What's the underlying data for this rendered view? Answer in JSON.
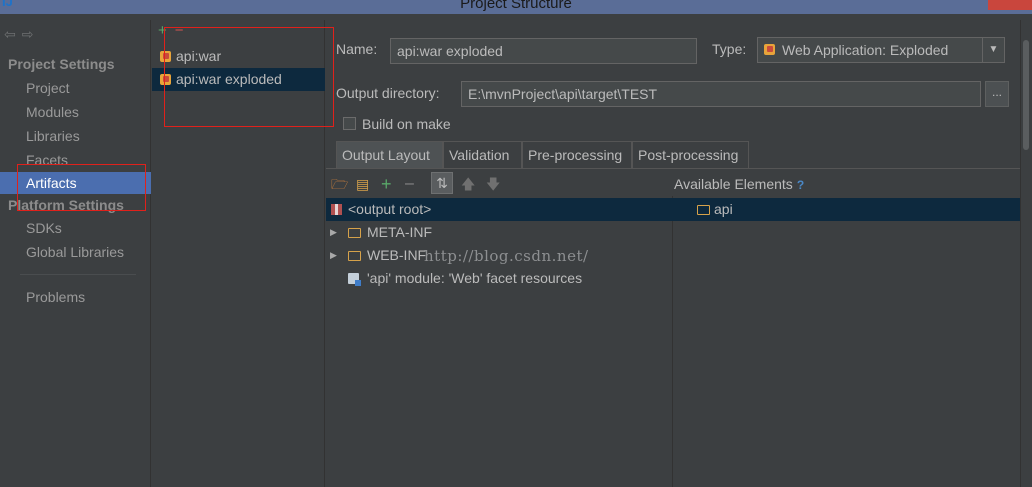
{
  "window": {
    "title": "Project Structure"
  },
  "sidebar": {
    "project_settings_header": "Project Settings",
    "project_items": [
      "Project",
      "Modules",
      "Libraries",
      "Facets",
      "Artifacts"
    ],
    "platform_settings_header": "Platform Settings",
    "platform_items": [
      "SDKs",
      "Global Libraries"
    ],
    "problems": "Problems",
    "selected": "Artifacts"
  },
  "artifacts_list": {
    "add_icon": "+",
    "remove_icon": "−",
    "items": [
      "api:war",
      "api:war exploded"
    ],
    "selected": "api:war exploded"
  },
  "form": {
    "name_label": "Name:",
    "name_value": "api:war exploded",
    "type_label": "Type:",
    "type_value": "Web Application: Exploded",
    "output_dir_label": "Output directory:",
    "output_dir_value": "E:\\mvnProject\\api\\target\\TEST",
    "browse_label": "...",
    "build_on_make_label": "Build on make",
    "build_on_make_checked": false
  },
  "tabs": [
    "Output Layout",
    "Validation",
    "Pre-processing",
    "Post-processing"
  ],
  "active_tab": "Output Layout",
  "layout_toolbar": {
    "icons": [
      "new-folder-icon",
      "archive-icon",
      "add-icon",
      "remove-icon",
      "sort-icon",
      "move-up-icon",
      "move-down-icon"
    ]
  },
  "available_elements": {
    "label": "Available Elements",
    "help": "?",
    "items": [
      "api"
    ]
  },
  "output_tree": {
    "root": "<output root>",
    "children": [
      "META-INF",
      "WEB-INF",
      "'api' module: 'Web' facet resources"
    ]
  },
  "watermark": "http://blog.csdn.net/",
  "colors": {
    "selection": "#4b6eaf",
    "tree_selection": "#0d293e",
    "annotation": "#e0211b",
    "background": "#3c3f41"
  }
}
